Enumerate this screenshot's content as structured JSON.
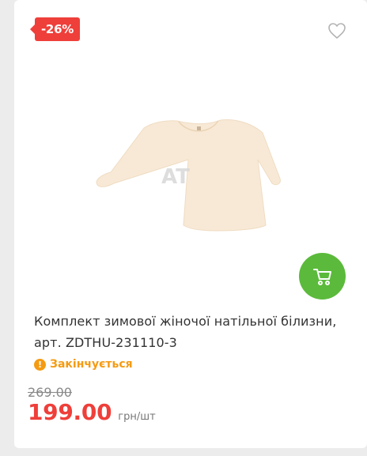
{
  "product": {
    "discount_badge": "-26%",
    "title": "Комплект зимової жіночої натільної білизни, арт. ZDTHU-231110-3",
    "stock_status": "Закінчується",
    "old_price": "269.00",
    "price": "199.00",
    "unit": "грн/шт",
    "image_watermark": "AT"
  },
  "icons": {
    "wishlist": "heart-outline-icon",
    "cart": "shopping-cart-icon",
    "stock": "exclamation-circle-icon"
  },
  "colors": {
    "discount": "#ef3f3a",
    "cart_button": "#5bba3b",
    "stock_warning": "#f59b12",
    "price": "#ef3f3a",
    "garment": "#f8e9d6"
  }
}
